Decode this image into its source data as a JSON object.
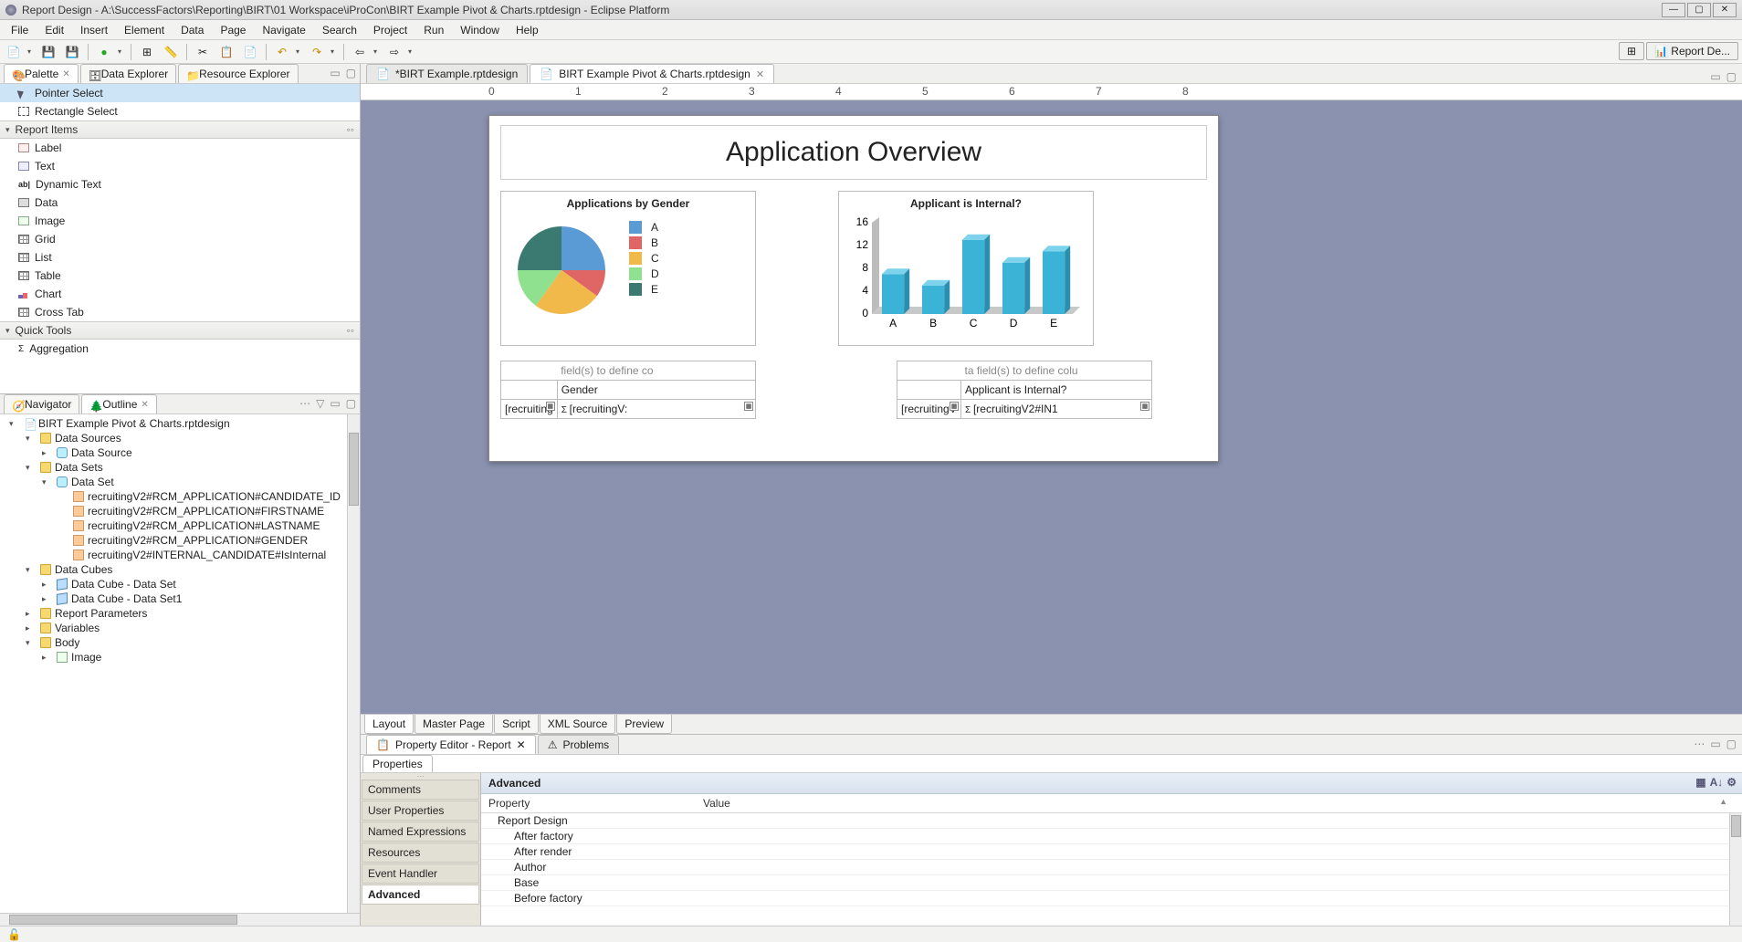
{
  "window": {
    "title": "Report Design - A:\\SuccessFactors\\Reporting\\BIRT\\01 Workspace\\iProCon\\BIRT Example Pivot & Charts.rptdesign - Eclipse Platform"
  },
  "menu": [
    "File",
    "Edit",
    "Insert",
    "Element",
    "Data",
    "Page",
    "Navigate",
    "Search",
    "Project",
    "Run",
    "Window",
    "Help"
  ],
  "perspective": {
    "label": "Report De..."
  },
  "left_tabs": {
    "top": [
      {
        "label": "Palette",
        "active": true
      },
      {
        "label": "Data Explorer",
        "active": false
      },
      {
        "label": "Resource Explorer",
        "active": false
      }
    ],
    "bottom": [
      {
        "label": "Navigator",
        "active": false
      },
      {
        "label": "Outline",
        "active": true
      }
    ]
  },
  "palette": {
    "pointers": [
      {
        "label": "Pointer Select",
        "selected": true
      },
      {
        "label": "Rectangle Select",
        "selected": false
      }
    ],
    "report_items_header": "Report Items",
    "report_items": [
      "Label",
      "Text",
      "Dynamic Text",
      "Data",
      "Image",
      "Grid",
      "List",
      "Table",
      "Chart",
      "Cross Tab"
    ],
    "quick_tools_header": "Quick Tools",
    "quick_tools": [
      "Aggregation"
    ]
  },
  "outline": {
    "root": "BIRT Example Pivot & Charts.rptdesign",
    "nodes": [
      {
        "label": "Data Sources",
        "depth": 1,
        "exp": true
      },
      {
        "label": "Data Source",
        "depth": 2
      },
      {
        "label": "Data Sets",
        "depth": 1,
        "exp": true
      },
      {
        "label": "Data Set",
        "depth": 2,
        "exp": true
      },
      {
        "label": "recruitingV2#RCM_APPLICATION#CANDIDATE_ID",
        "depth": 3
      },
      {
        "label": "recruitingV2#RCM_APPLICATION#FIRSTNAME",
        "depth": 3
      },
      {
        "label": "recruitingV2#RCM_APPLICATION#LASTNAME",
        "depth": 3
      },
      {
        "label": "recruitingV2#RCM_APPLICATION#GENDER",
        "depth": 3
      },
      {
        "label": "recruitingV2#INTERNAL_CANDIDATE#IsInternal",
        "depth": 3
      },
      {
        "label": "Data Cubes",
        "depth": 1,
        "exp": true
      },
      {
        "label": "Data Cube - Data Set",
        "depth": 2
      },
      {
        "label": "Data Cube - Data Set1",
        "depth": 2
      },
      {
        "label": "Report Parameters",
        "depth": 1
      },
      {
        "label": "Variables",
        "depth": 1
      },
      {
        "label": "Body",
        "depth": 1,
        "exp": true
      },
      {
        "label": "Image",
        "depth": 2
      }
    ]
  },
  "editor_tabs": [
    {
      "label": "*BIRT Example.rptdesign",
      "active": false
    },
    {
      "label": "BIRT Example Pivot & Charts.rptdesign",
      "active": true
    }
  ],
  "ruler_marks": [
    "0",
    "1",
    "2",
    "3",
    "4",
    "5",
    "6",
    "7",
    "8"
  ],
  "report": {
    "title": "Application Overview",
    "pie_title": "Applications by Gender",
    "bar_title": "Applicant is Internal?",
    "grid1": {
      "hint": "field(s) to define co",
      "header": "Gender",
      "cell1": "[recruiting",
      "cell2": "[recruitingV:"
    },
    "grid2": {
      "hint": "ta field(s) to define colu",
      "header": "Applicant is Internal?",
      "cell1": "[recruitingV",
      "cell2": "[recruitingV2#IN1"
    }
  },
  "chart_data": [
    {
      "type": "pie",
      "title": "Applications by Gender",
      "categories": [
        "A",
        "B",
        "C",
        "D",
        "E"
      ],
      "values": [
        25,
        10,
        25,
        15,
        25
      ],
      "colors": [
        "#5a9bd5",
        "#e06666",
        "#f1b94a",
        "#8fe08f",
        "#3a7a70"
      ]
    },
    {
      "type": "bar",
      "title": "Applicant is Internal?",
      "categories": [
        "A",
        "B",
        "C",
        "D",
        "E"
      ],
      "values": [
        7,
        5,
        13,
        9,
        11
      ],
      "ylim": [
        0,
        16
      ],
      "yticks": [
        0,
        4,
        8,
        12,
        16
      ],
      "xlabel": "",
      "ylabel": ""
    }
  ],
  "editor_bottom_tabs": [
    "Layout",
    "Master Page",
    "Script",
    "XML Source",
    "Preview"
  ],
  "editor_bottom_active": "Layout",
  "prop_tabs": [
    {
      "label": "Property Editor - Report",
      "active": true
    },
    {
      "label": "Problems",
      "active": false
    }
  ],
  "prop_subtab": "Properties",
  "prop_categories": [
    "Comments",
    "User Properties",
    "Named Expressions",
    "Resources",
    "Event Handler",
    "Advanced"
  ],
  "prop_selected_category": "Advanced",
  "prop_heading": "Advanced",
  "prop_columns": [
    "Property",
    "Value"
  ],
  "prop_rows": [
    {
      "label": "Report Design",
      "lvl": 0
    },
    {
      "label": "After factory",
      "lvl": 1
    },
    {
      "label": "After render",
      "lvl": 1
    },
    {
      "label": "Author",
      "lvl": 1
    },
    {
      "label": "Base",
      "lvl": 1
    },
    {
      "label": "Before factory",
      "lvl": 1
    }
  ]
}
